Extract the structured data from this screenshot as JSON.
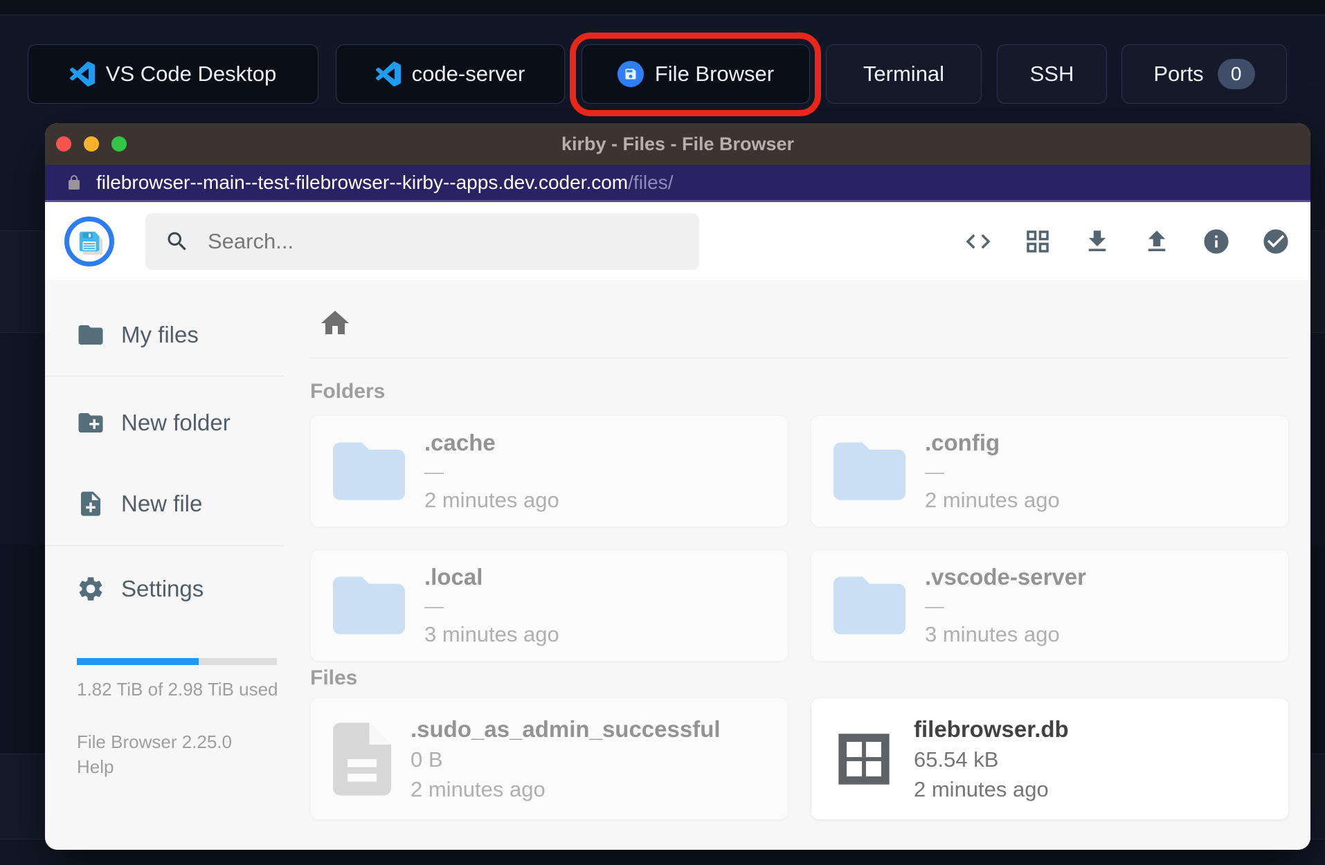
{
  "taskbar": {
    "tabs": {
      "vscode_desktop": "VS Code Desktop",
      "code_server": "code-server",
      "file_browser": "File Browser",
      "terminal": "Terminal",
      "ssh": "SSH",
      "ports": "Ports",
      "ports_badge": "0"
    }
  },
  "window": {
    "title": "kirby - Files - File Browser",
    "url_host": "filebrowser--main--test-filebrowser--kirby--apps.dev.coder.com",
    "url_path": "/files/"
  },
  "app": {
    "search": {
      "placeholder": "Search..."
    },
    "sidebar": {
      "my_files": "My files",
      "new_folder": "New folder",
      "new_file": "New file",
      "settings": "Settings",
      "usage_text": "1.82 TiB of 2.98 TiB used",
      "usage_percent": 61,
      "usage_bar_style": "width:61%",
      "version": "File Browser 2.25.0",
      "help": "Help"
    },
    "listing": {
      "folders_header": "Folders",
      "files_header": "Files",
      "folders": [
        {
          "name": ".cache",
          "size": "—",
          "modified": "2 minutes ago"
        },
        {
          "name": ".config",
          "size": "—",
          "modified": "2 minutes ago"
        },
        {
          "name": ".local",
          "size": "—",
          "modified": "3 minutes ago"
        },
        {
          "name": ".vscode-server",
          "size": "—",
          "modified": "3 minutes ago"
        }
      ],
      "files": [
        {
          "name": ".sudo_as_admin_successful",
          "size": "0 B",
          "modified": "2 minutes ago"
        },
        {
          "name": "filebrowser.db",
          "size": "65.54 kB",
          "modified": "2 minutes ago"
        }
      ]
    },
    "colors": {
      "accent_blue": "#2196f3",
      "logo_ring": "#2c7cf6",
      "folder_icon": "#a6cdf2",
      "annotation_red": "#e8271a",
      "urlbar": "#2a2363",
      "titlebar": "#3b3431"
    }
  }
}
